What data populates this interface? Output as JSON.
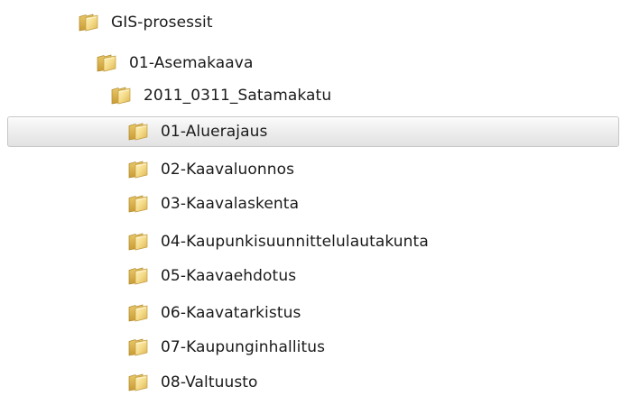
{
  "tree": {
    "items": [
      {
        "label": "GIS-prosessit",
        "icon": "folder-icon",
        "level": 0,
        "selected": false
      },
      {
        "label": "01-Asemakaava",
        "icon": "folder-icon",
        "level": 1,
        "selected": false
      },
      {
        "label": "2011_0311_Satamakatu",
        "icon": "folder-icon",
        "level": 2,
        "selected": false
      },
      {
        "label": "01-Aluerajaus",
        "icon": "folder-icon",
        "level": 3,
        "selected": true
      },
      {
        "label": "02-Kaavaluonnos",
        "icon": "folder-icon",
        "level": 3,
        "selected": false
      },
      {
        "label": "03-Kaavalaskenta",
        "icon": "folder-icon",
        "level": 3,
        "selected": false
      },
      {
        "label": "04-Kaupunkisuunnittelulautakunta",
        "icon": "folder-icon",
        "level": 3,
        "selected": false
      },
      {
        "label": "05-Kaavaehdotus",
        "icon": "folder-icon",
        "level": 3,
        "selected": false
      },
      {
        "label": "06-Kaavatarkistus",
        "icon": "folder-icon",
        "level": 3,
        "selected": false
      },
      {
        "label": "07-Kaupunginhallitus",
        "icon": "folder-icon",
        "level": 3,
        "selected": false
      },
      {
        "label": "08-Valtuusto",
        "icon": "folder-icon",
        "level": 3,
        "selected": false
      }
    ]
  },
  "colors": {
    "folder_light": "#f7e39a",
    "folder_dark": "#d9b653",
    "selection_border": "#c6c6c6"
  }
}
